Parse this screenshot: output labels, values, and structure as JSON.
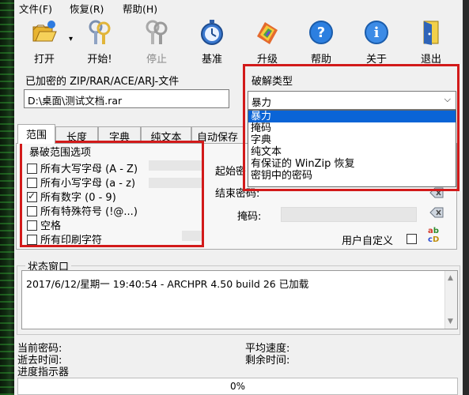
{
  "menu": [
    "文件(F)",
    "恢复(R)",
    "帮助(H)"
  ],
  "toolbar": [
    {
      "label": "打开",
      "icon": "folder-open-icon",
      "enabled": true
    },
    {
      "label": "开始!",
      "icon": "key-start-icon",
      "enabled": true
    },
    {
      "label": "停止",
      "icon": "key-stop-icon",
      "enabled": false
    },
    {
      "label": "基准",
      "icon": "stopwatch-icon",
      "enabled": true
    },
    {
      "label": "升级",
      "icon": "upgrade-icon",
      "enabled": true
    },
    {
      "label": "帮助",
      "icon": "help-icon",
      "enabled": true
    },
    {
      "label": "关于",
      "icon": "info-icon",
      "enabled": true
    },
    {
      "label": "退出",
      "icon": "exit-door-icon",
      "enabled": true
    }
  ],
  "archive": {
    "label": "已加密的 ZIP/RAR/ACE/ARJ-文件",
    "path": "D:\\桌面\\测试文档.rar"
  },
  "attack": {
    "label": "破解类型",
    "selected": "暴力",
    "options": [
      "暴力",
      "掩码",
      "字典",
      "纯文本",
      "有保证的 WinZip 恢复",
      "密钥中的密码"
    ]
  },
  "tabs": [
    "范围",
    "长度",
    "字典",
    "纯文本",
    "自动保存"
  ],
  "range": {
    "group_title": "暴破范围选项",
    "options": [
      {
        "label": "所有大写字母 (A - Z)",
        "checked": false
      },
      {
        "label": "所有小写字母 (a - z)",
        "checked": false
      },
      {
        "label": "所有数字 (0 - 9)",
        "checked": true
      },
      {
        "label": "所有特殊符号 (!@...)",
        "checked": false
      },
      {
        "label": "空格",
        "checked": false
      },
      {
        "label": "所有印刷字符",
        "checked": false
      }
    ],
    "start_label": "起始密",
    "end_label": "结束密码:",
    "mask_label": "掩码:",
    "user_defined_label": "用户自定义"
  },
  "status": {
    "title": "状态窗口",
    "log": "2017/6/12/星期一 19:40:54 - ARCHPR 4.50 build 26 已加载"
  },
  "bottom": {
    "current_password": "当前密码:",
    "elapsed": "逝去时间:",
    "progress_label": "进度指示器",
    "avg_speed": "平均速度:",
    "remaining": "剩余时间:",
    "progress_text": "0%",
    "progress_value": 0
  },
  "colors": {
    "highlight": "#d21a1a",
    "selection": "#0a64d6"
  }
}
